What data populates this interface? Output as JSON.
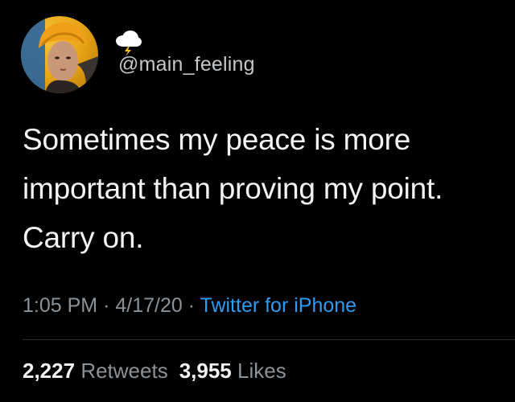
{
  "tweet": {
    "handle": "@main_feeling",
    "display_name_icon": "cloud-with-lightning-emoji",
    "body_lines": [
      "Sometimes my peace is more",
      "important than proving my point.",
      "Carry on."
    ],
    "time": "1:05 PM",
    "separator": "·",
    "date": "4/17/20",
    "source": "Twitter for iPhone",
    "retweets_count": "2,227",
    "retweets_label": "Retweets",
    "likes_count": "3,955",
    "likes_label": "Likes"
  },
  "colors": {
    "background": "#000000",
    "text": "#f1f3f4",
    "secondary_text": "#8b9298",
    "link": "#2d9bf0",
    "divider": "#2a2d30",
    "avatar_ring": "#f2b21b"
  }
}
